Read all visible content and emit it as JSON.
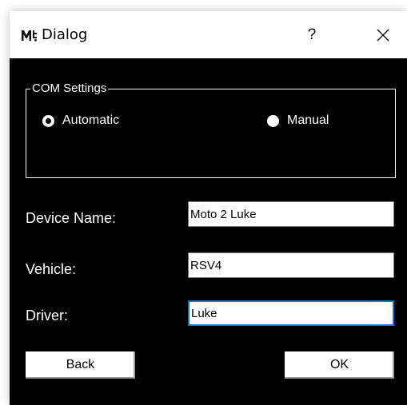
{
  "window": {
    "title": "Dialog",
    "app_icon": "mdi-logo-icon",
    "help_label": "?",
    "close_icon": "close-icon"
  },
  "com_settings": {
    "title": "COM Settings",
    "options": [
      {
        "label": "Automatic",
        "checked": true
      },
      {
        "label": "Manual",
        "checked": false
      }
    ]
  },
  "fields": {
    "device_name": {
      "label": "Device Name:",
      "value": "Moto 2 Luke"
    },
    "vehicle": {
      "label": "Vehicle:",
      "value": "RSV4"
    },
    "driver": {
      "label": "Driver:",
      "value": "Luke"
    }
  },
  "buttons": {
    "back_label": "Back",
    "ok_label": "OK"
  },
  "colors": {
    "background": "#000000",
    "foreground": "#ffffff",
    "focus": "#0078d7"
  }
}
